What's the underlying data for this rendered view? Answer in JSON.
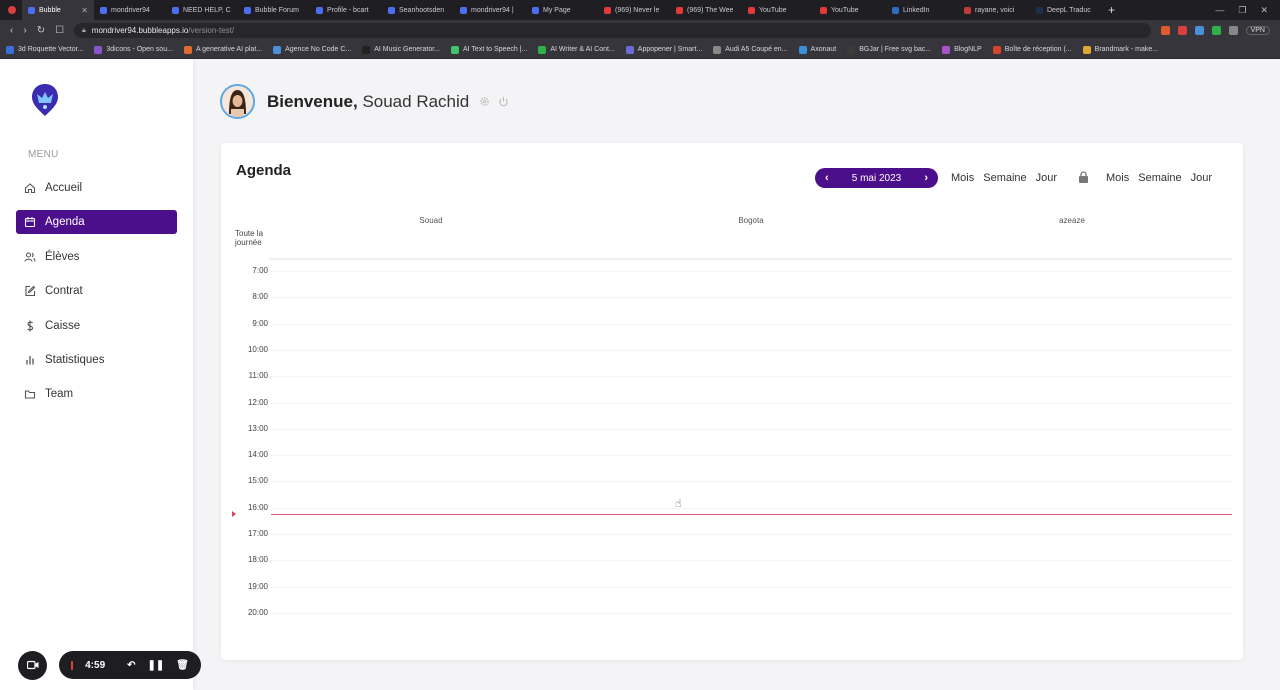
{
  "browser": {
    "tabs": [
      {
        "title": "Bubble",
        "active": true,
        "color": "#4c6ef5"
      },
      {
        "title": "mondriver94",
        "active": false,
        "color": "#4c6ef5"
      },
      {
        "title": "NEED HELP, C",
        "active": false,
        "color": "#4c6ef5"
      },
      {
        "title": "Bubble Forum",
        "active": false,
        "color": "#4c6ef5"
      },
      {
        "title": "Profile - bcart",
        "active": false,
        "color": "#4c6ef5"
      },
      {
        "title": "Seanhootsden",
        "active": false,
        "color": "#4c6ef5"
      },
      {
        "title": "mondriver94 |",
        "active": false,
        "color": "#4c6ef5"
      },
      {
        "title": "My Page",
        "active": false,
        "color": "#4c6ef5"
      },
      {
        "title": "(969) Never le",
        "active": false,
        "color": "#e53935"
      },
      {
        "title": "(969) The Wee",
        "active": false,
        "color": "#e53935"
      },
      {
        "title": "YouTube",
        "active": false,
        "color": "#e53935"
      },
      {
        "title": "YouTube",
        "active": false,
        "color": "#e53935"
      },
      {
        "title": "LinkedIn",
        "active": false,
        "color": "#2d6cc0"
      },
      {
        "title": "rayane, voici",
        "active": false,
        "color": "#c23b3b"
      },
      {
        "title": "DeepL Traduc",
        "active": false,
        "color": "#1b2f4f"
      }
    ],
    "url_host": "mondriver94.bubbleapps.io",
    "url_path": "/version-test/",
    "vpn_label": "VPN",
    "bookmarks": [
      {
        "label": "3d Roquette Vector...",
        "color": "#3a6fd8"
      },
      {
        "label": "3dicons - Open sou...",
        "color": "#8855cc"
      },
      {
        "label": "A generative AI plat...",
        "color": "#e06b2f"
      },
      {
        "label": "Agence No Code C...",
        "color": "#4a90d9"
      },
      {
        "label": "AI Music Generator...",
        "color": "#222222"
      },
      {
        "label": "AI Text to Speech |...",
        "color": "#3ec46d"
      },
      {
        "label": "AI Writer & AI Cont...",
        "color": "#2fb14a"
      },
      {
        "label": "Appopener | Smart...",
        "color": "#6b6bd6"
      },
      {
        "label": "Audi A5 Coupé en...",
        "color": "#888888"
      },
      {
        "label": "Axonaut",
        "color": "#3a8fd8"
      },
      {
        "label": "BGJar | Free svg bac...",
        "color": "#3b3b3b"
      },
      {
        "label": "BlogNLP",
        "color": "#a855cc"
      },
      {
        "label": "Boîte de réception (...",
        "color": "#d8432f"
      },
      {
        "label": "Brandmark - make...",
        "color": "#e0a82f"
      }
    ]
  },
  "sidebar": {
    "menu_label": "MENU",
    "items": [
      {
        "label": "Accueil",
        "icon": "home-icon",
        "active": false
      },
      {
        "label": "Agenda",
        "icon": "calendar-icon",
        "active": true
      },
      {
        "label": "Élèves",
        "icon": "users-icon",
        "active": false
      },
      {
        "label": "Contrat",
        "icon": "edit-icon",
        "active": false
      },
      {
        "label": "Caisse",
        "icon": "dollar-icon",
        "active": false
      },
      {
        "label": "Statistiques",
        "icon": "bar-chart-icon",
        "active": false
      },
      {
        "label": "Team",
        "icon": "folder-icon",
        "active": false
      }
    ],
    "accent": "#4c0f8c"
  },
  "recorder": {
    "time": "4:59"
  },
  "header": {
    "greeting": "Bienvenue,",
    "user_name": "Souad Rachid"
  },
  "agenda": {
    "title": "Agenda",
    "date": "5 mai 2023",
    "views": [
      "Mois",
      "Semaine",
      "Jour"
    ],
    "views_secondary": [
      "Mois",
      "Semaine",
      "Jour"
    ],
    "columns": [
      "Souad",
      "Bogota",
      "azeaze"
    ],
    "allday_label": "Toute la journée",
    "hours": [
      "7:00",
      "8:00",
      "9:00",
      "10:00",
      "11:00",
      "12:00",
      "13:00",
      "14:00",
      "15:00",
      "16:00",
      "17:00",
      "18:00",
      "19:00",
      "20:00"
    ],
    "now_color": "#e05a7a"
  }
}
